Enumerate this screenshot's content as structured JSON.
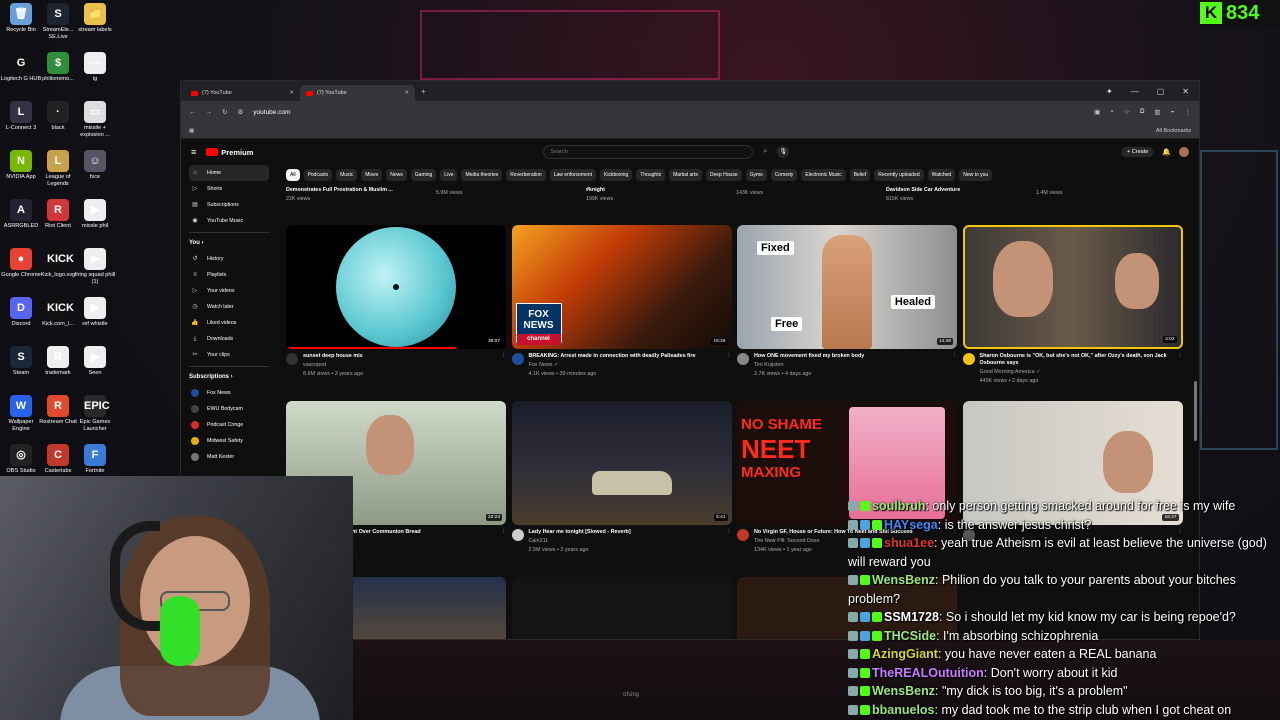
{
  "kick_counter": {
    "value": "834",
    "logo": "K"
  },
  "desktop_icons": [
    {
      "label": "Recycle Bin",
      "glyph": "🗑",
      "color": "#6aa0d8"
    },
    {
      "label": "StreamEle... SE.Live",
      "glyph": "S",
      "color": "#1e2530"
    },
    {
      "label": "stream labels",
      "glyph": "📁",
      "color": "#e8c04a"
    },
    {
      "label": "Logitech G HUB",
      "glyph": "G",
      "color": "#111"
    },
    {
      "label": "philionemo...",
      "glyph": "$",
      "color": "#2f8f3a"
    },
    {
      "label": "ig",
      "glyph": "—",
      "color": "#eee"
    },
    {
      "label": "L-Connect 3",
      "glyph": "L",
      "color": "#334"
    },
    {
      "label": "black",
      "glyph": "·",
      "color": "#222"
    },
    {
      "label": "missile + explosion ...",
      "glyph": "▭",
      "color": "#ddd"
    },
    {
      "label": "NVIDIA App",
      "glyph": "N",
      "color": "#76b900"
    },
    {
      "label": "League of Legends",
      "glyph": "L",
      "color": "#c8a24a"
    },
    {
      "label": "fsce",
      "glyph": "☺",
      "color": "#556"
    },
    {
      "label": "ASRRGBLED",
      "glyph": "A",
      "color": "#223"
    },
    {
      "label": "Riot Client",
      "glyph": "R",
      "color": "#d13639"
    },
    {
      "label": "missle phil",
      "glyph": "▶",
      "color": "#eee"
    },
    {
      "label": "Google Chrome",
      "glyph": "●",
      "color": "#e94235"
    },
    {
      "label": "Kick_logo.svg",
      "glyph": "KICK",
      "color": "#111"
    },
    {
      "label": "firing squad phill (1)",
      "glyph": "▶",
      "color": "#eee"
    },
    {
      "label": "Discord",
      "glyph": "D",
      "color": "#5865f2"
    },
    {
      "label": "Kick.com_l...",
      "glyph": "KICK",
      "color": "#111"
    },
    {
      "label": "ref whistle",
      "glyph": "▶",
      "color": "#eee"
    },
    {
      "label": "Steam",
      "glyph": "S",
      "color": "#1b2838"
    },
    {
      "label": "trademark",
      "glyph": "R",
      "color": "#eee"
    },
    {
      "label": "Seen",
      "glyph": "▶",
      "color": "#eee"
    },
    {
      "label": "Wallpaper Engine",
      "glyph": "W",
      "color": "#2563eb"
    },
    {
      "label": "Restream Chat",
      "glyph": "R",
      "color": "#e04a2a"
    },
    {
      "label": "Epic Games Launcher",
      "glyph": "EPIC",
      "color": "#2a2a2a"
    },
    {
      "label": "OBS Studio",
      "glyph": "◎",
      "color": "#222"
    },
    {
      "label": "Casterlabs",
      "glyph": "C",
      "color": "#c0392b"
    },
    {
      "label": "Fortnite",
      "glyph": "F",
      "color": "#3a7bd5"
    }
  ],
  "browser": {
    "tabs": [
      {
        "label": "(7) YouTube"
      },
      {
        "label": "(7) YouTube"
      }
    ],
    "new_tab": "+",
    "window_controls": [
      "✦",
      "—",
      "▢",
      "✕"
    ],
    "url": "youtube.com",
    "all_bookmarks": "All Bookmarks"
  },
  "youtube": {
    "logo_text": "Premium",
    "search_placeholder": "Search",
    "create_label": "+ Create",
    "notif_count": "9+",
    "sidebar_main": [
      {
        "label": "Home",
        "icon": "⌂"
      },
      {
        "label": "Shorts",
        "icon": "▷"
      },
      {
        "label": "Subscriptions",
        "icon": "▤"
      },
      {
        "label": "YouTube Music",
        "icon": "◉"
      }
    ],
    "you_header": "You ›",
    "sidebar_you": [
      {
        "label": "History",
        "icon": "↺"
      },
      {
        "label": "Playlists",
        "icon": "≡"
      },
      {
        "label": "Your videos",
        "icon": "▷"
      },
      {
        "label": "Watch later",
        "icon": "◷"
      },
      {
        "label": "Liked videos",
        "icon": "👍"
      },
      {
        "label": "Downloads",
        "icon": "⤓"
      },
      {
        "label": "Your clips",
        "icon": "✂"
      }
    ],
    "subscriptions_header": "Subscriptions ›",
    "subscriptions": [
      {
        "label": "Fox News",
        "color": "#1f4e9c"
      },
      {
        "label": "EWU Bodycam",
        "color": "#444"
      },
      {
        "label": "Podcast Cringe",
        "color": "#d93025"
      },
      {
        "label": "Midwest Safety",
        "color": "#e8b100"
      },
      {
        "label": "Matt Kester",
        "color": "#777"
      }
    ],
    "chips": [
      "All",
      "Podcasts",
      "Music",
      "Mixes",
      "News",
      "Gaming",
      "Live",
      "Media theories",
      "Reverberation",
      "Law enforcement",
      "Kickboxing",
      "Thoughts",
      "Martial arts",
      "Deep House",
      "Gyms",
      "Comedy",
      "Electronic Music",
      "Belief",
      "Recently uploaded",
      "Watched",
      "New to you"
    ],
    "previous_row": [
      {
        "title": "Demonstrates Full Prostration & Muslim ...",
        "meta": "22K views"
      },
      {
        "title": "",
        "meta": "5.9M views"
      },
      {
        "title": "#knight",
        "meta": "199K views"
      },
      {
        "title": "",
        "meta": "143K views"
      },
      {
        "title": "Davidson Side Car Adventure",
        "meta": "815K views"
      },
      {
        "title": "",
        "meta": "1.4M views"
      }
    ],
    "videos": [
      {
        "title": "sunset deep house mix",
        "channel": "vascopod",
        "stats": "8.6M views • 3 years ago",
        "duration": "38:07",
        "avatar": "#333"
      },
      {
        "title": "BREAKING: Arrest made in connection with deadly Palisades fire",
        "channel": "Fox News ✓",
        "stats": "4.1K views • 39 minutes ago",
        "duration": "15:26",
        "avatar": "#1f4e9c"
      },
      {
        "title": "How ONE movement fixed my broken body",
        "channel": "Tim Kuijsten",
        "stats": "2.7K views • 4 days ago",
        "duration": "14:48",
        "avatar": "#888"
      },
      {
        "title": "Sharon Osbourne is \"OK, but she's not OK,\" after Ozzy's death, son Jack Osbourne says",
        "channel": "Good Morning America ✓",
        "stats": "445K views • 2 days ago",
        "duration": "3:02",
        "avatar": "#f2c511"
      },
      {
        "title": "...tes Woman in Fight Over Communion Bread",
        "channel": "",
        "stats": "",
        "duration": "22:23",
        "avatar": "#555"
      },
      {
        "title": "Lady Hear me tonight [Slowed - Reverb]",
        "channel": "Cain211",
        "stats": "2.5M views • 2 years ago",
        "duration": "5:41",
        "avatar": "#ccc"
      },
      {
        "title": "No Virgin GF, House or Future: How To Neet and Still Succeed",
        "channel": "The New Pill: Second Dose",
        "stats": "134K views • 1 year ago",
        "duration": "",
        "avatar": "#c0392b"
      },
      {
        "title": "",
        "channel": "",
        "stats": "",
        "duration": "16:37",
        "avatar": "#555"
      }
    ],
    "thumb_text": {
      "fox1": "FOX",
      "fox2": "NEWS",
      "fox3": "channel",
      "fixed": "Fixed",
      "healed": "Healed",
      "free": "Free",
      "neet1": "NO SHAME",
      "neet2": "NEET",
      "neet3": "MAXING",
      "bottom_label": "ofsing"
    }
  },
  "chat": [
    {
      "badges": [
        "bot",
        "k"
      ],
      "user": "soulbruh",
      "color": "#9be67a",
      "text": "only person getting smacked around for free is my wife"
    },
    {
      "badges": [
        "bot",
        "blue",
        "k"
      ],
      "user": "HAYsega",
      "color": "#3d87f5",
      "text": "is the answer jesus christ?"
    },
    {
      "badges": [
        "bot",
        "blue",
        "k"
      ],
      "user": "shua1ee",
      "color": "#e0342c",
      "text": "yeah true Atheism is evil at least believe the universe (god) will reward you"
    },
    {
      "badges": [
        "bot",
        "k"
      ],
      "user": "WensBenz",
      "color": "#9be67a",
      "text": "Philion do you talk to your parents about your bitches problem?"
    },
    {
      "badges": [
        "bot",
        "blue",
        "k"
      ],
      "user": "SSM1728",
      "color": "#ffffff",
      "text": "So i should let my kid know my car is being repoe'd?"
    },
    {
      "badges": [
        "bot",
        "blue",
        "k"
      ],
      "user": "THCSide",
      "color": "#9be67a",
      "text": "I'm absorbing schizophrenia"
    },
    {
      "badges": [
        "bot",
        "k"
      ],
      "user": "AzingGiant",
      "color": "#d6d628",
      "text": "you have never eaten a REAL banana"
    },
    {
      "badges": [
        "bot",
        "k"
      ],
      "user": "TheREALOutuition",
      "color": "#c77dff",
      "text": "Don't worry about it kid"
    },
    {
      "badges": [
        "bot",
        "k"
      ],
      "user": "WensBenz",
      "color": "#9be67a",
      "text": "\"my dick is too big, it's a problem\""
    },
    {
      "badges": [
        "bot",
        "k"
      ],
      "user": "bbanuelos",
      "color": "#9be67a",
      "text": "my dad took me to the strip club when I got cheat on"
    }
  ]
}
